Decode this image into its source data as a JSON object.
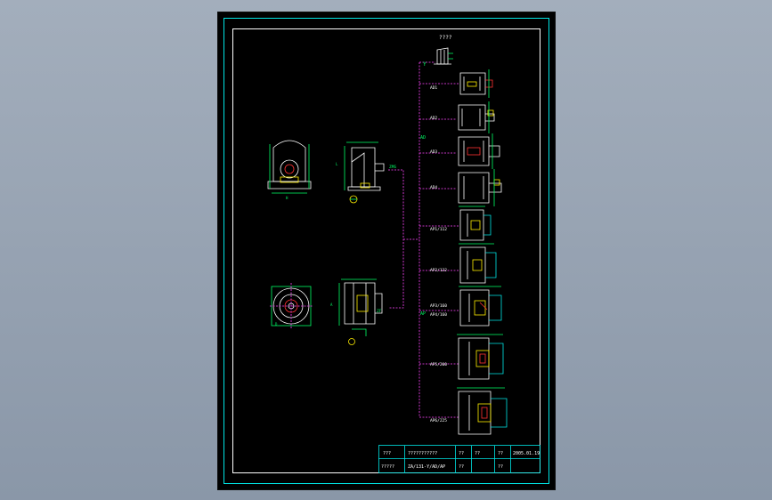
{
  "viewport": {
    "background_top": "#a3aebc",
    "background_bottom": "#8a97a8"
  },
  "colors": {
    "frame": "#00e5e5",
    "part_outline": "#ffffff",
    "dimension": "#00ff66",
    "leader": "#ff44ff",
    "highlight": "#ffee00",
    "shaft": "#ff3333"
  },
  "diagram": {
    "top_label": "????",
    "branch_top_tag": "Y",
    "branch_mid_tag": "AD",
    "branch_bottom_tag": "AP",
    "side_view_top_tag": "ZMS",
    "side_view_bottom_tag": "ZF",
    "ad_labels": [
      "AD1",
      "AD2",
      "AD3",
      "AD4"
    ],
    "ap_labels": [
      "AP1/112",
      "AP2/132",
      "AP3/160",
      "AP4/160",
      "AP5/200",
      "AP6/225"
    ]
  },
  "title_block": {
    "row1": [
      "???",
      "???????????",
      "??",
      "??",
      "??",
      "2005.01.19"
    ],
    "row2": [
      "?????",
      "ZA/131-Y/AD/AP",
      "??",
      "",
      "??",
      ""
    ]
  }
}
